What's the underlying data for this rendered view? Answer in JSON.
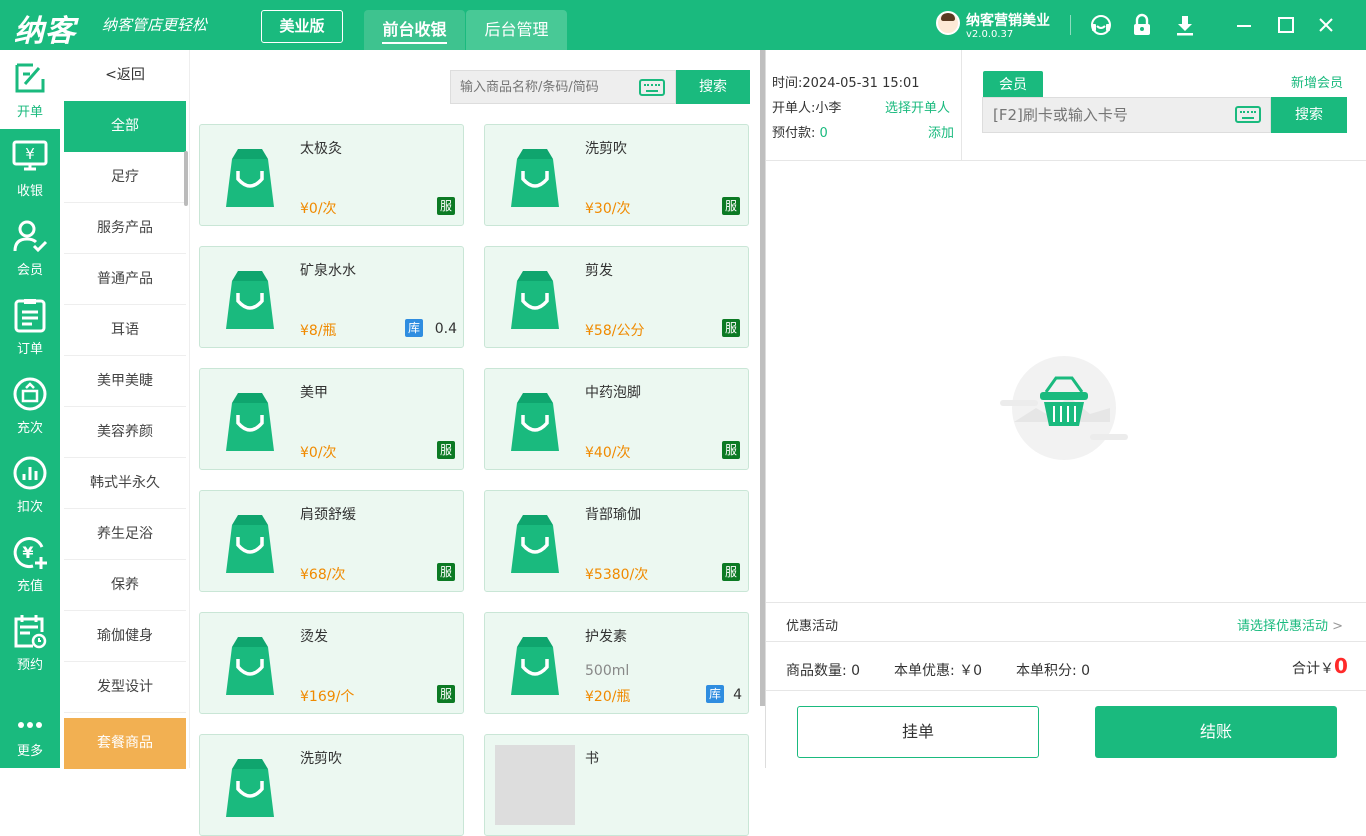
{
  "app": {
    "logo": "纳客",
    "slogan": "纳客管店更轻松",
    "edition": "美业版"
  },
  "top_tabs": [
    {
      "label": "前台收银",
      "active": true
    },
    {
      "label": "后台管理",
      "active": false
    }
  ],
  "user": {
    "name": "纳客营销美业",
    "version": "v2.0.0.37"
  },
  "window_icons": [
    "headset-icon",
    "lock-icon",
    "download-icon",
    "minimize-icon",
    "maximize-icon",
    "close-icon"
  ],
  "nav": [
    {
      "label": "开单",
      "icon": "open-order-icon",
      "active": true
    },
    {
      "label": "收银",
      "icon": "cashier-icon"
    },
    {
      "label": "会员",
      "icon": "member-icon"
    },
    {
      "label": "订单",
      "icon": "order-icon"
    },
    {
      "label": "充次",
      "icon": "recharge-times-icon"
    },
    {
      "label": "扣次",
      "icon": "deduct-times-icon"
    },
    {
      "label": "充值",
      "icon": "recharge-icon"
    },
    {
      "label": "预约",
      "icon": "appointment-icon"
    },
    {
      "label": "更多",
      "icon": "more-icon"
    }
  ],
  "categories": {
    "back": "返回",
    "items": [
      "全部",
      "足疗",
      "服务产品",
      "普通产品",
      "耳语",
      "美甲美睫",
      "美容养颜",
      "韩式半永久",
      "养生足浴",
      "保养",
      "瑜伽健身",
      "发型设计"
    ],
    "package": "套餐商品"
  },
  "search": {
    "placeholder": "输入商品名称/条码/简码",
    "button": "搜索"
  },
  "products": [
    {
      "name": "太极灸",
      "spec": "",
      "price": "¥0/次",
      "tag": "服",
      "stock": ""
    },
    {
      "name": "洗剪吹",
      "spec": "",
      "price": "¥30/次",
      "tag": "服",
      "stock": ""
    },
    {
      "name": "矿泉水水",
      "spec": "",
      "price": "¥8/瓶",
      "tag": "库",
      "stock": "0.4"
    },
    {
      "name": "剪发",
      "spec": "",
      "price": "¥58/公分",
      "tag": "服",
      "stock": ""
    },
    {
      "name": "美甲",
      "spec": "",
      "price": "¥0/次",
      "tag": "服",
      "stock": ""
    },
    {
      "name": "中药泡脚",
      "spec": "",
      "price": "¥40/次",
      "tag": "服",
      "stock": ""
    },
    {
      "name": "肩颈舒缓",
      "spec": "",
      "price": "¥68/次",
      "tag": "服",
      "stock": ""
    },
    {
      "name": "背部瑜伽",
      "spec": "",
      "price": "¥5380/次",
      "tag": "服",
      "stock": ""
    },
    {
      "name": "烫发",
      "spec": "",
      "price": "¥169/个",
      "tag": "服",
      "stock": ""
    },
    {
      "name": "护发素",
      "spec": "500ml",
      "price": "¥20/瓶",
      "tag": "库",
      "stock": "4"
    },
    {
      "name": "洗剪吹",
      "spec": "",
      "price": "",
      "tag": "",
      "stock": ""
    },
    {
      "name": "书",
      "spec": "",
      "price": "",
      "tag": "",
      "stock": ""
    }
  ],
  "order": {
    "time_label": "时间:",
    "time": "2024-05-31 15:01",
    "operator_label": "开单人:",
    "operator": "小李",
    "select_operator": "选择开单人",
    "prepay_label": "预付款:",
    "prepay": "0",
    "add": "添加",
    "member_tab": "会员",
    "new_member": "新增会员",
    "card_placeholder": "[F2]刷卡或输入卡号",
    "card_search": "搜索",
    "promo_label": "优惠活动",
    "promo_select": "请选择优惠活动",
    "qty_label": "商品数量:",
    "qty": "0",
    "discount_label": "本单优惠:",
    "discount": "￥0",
    "points_label": "本单积分:",
    "points": "0",
    "total_label": "合计￥",
    "total": "0",
    "hold_button": "挂单",
    "checkout_button": "结账"
  },
  "colors": {
    "brand": "#1aba7e",
    "price": "#f08a00",
    "service_tag": "#0c7a24",
    "stock_tag": "#2f8de0",
    "package": "#f2b052",
    "total": "#ff2a2a"
  }
}
